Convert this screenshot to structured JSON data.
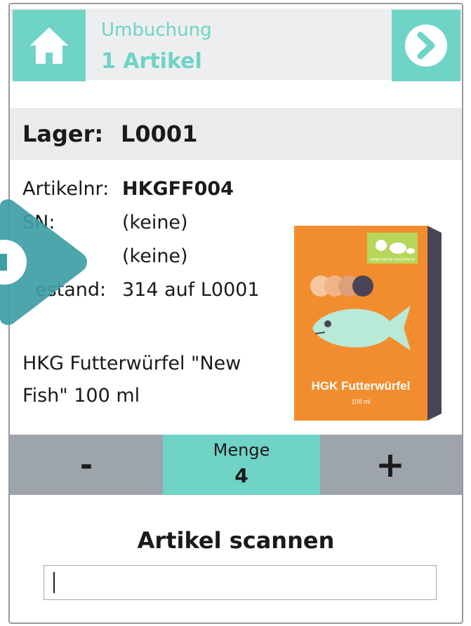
{
  "header": {
    "subtitle": "Umbuchung",
    "title": "1 Artikel",
    "home_icon": "home-icon",
    "next_icon": "chevron-right-circle-icon"
  },
  "lager": {
    "label": "Lager:",
    "value": "L0001"
  },
  "details": {
    "artikelnr_label": "Artikelnr:",
    "artikelnr_value": "HKGFF004",
    "sn_label": "SN:",
    "sn_value": "(keine)",
    "charge_value": "(keine)",
    "bestand_label": "estand:",
    "bestand_value": "314 auf L0001"
  },
  "description_line1": "HKG Futterwürfel \"New",
  "description_line2": "Fish\" 100 ml",
  "product_image": {
    "name": "HGK Futterwürfel",
    "size": "100 ml",
    "badge_text": "HUND KATZE GOLDFISCH"
  },
  "quantity": {
    "minus_label": "-",
    "label": "Menge",
    "value": "4",
    "plus_label": "+"
  },
  "scan": {
    "title": "Artikel scannen",
    "value": ""
  },
  "colors": {
    "accent": "#6fd3c6",
    "bar_gray": "#9ea4ac",
    "panel_gray": "#e9ebec",
    "box_orange": "#f28d2f",
    "overlay_teal": "#3d9ea5"
  }
}
